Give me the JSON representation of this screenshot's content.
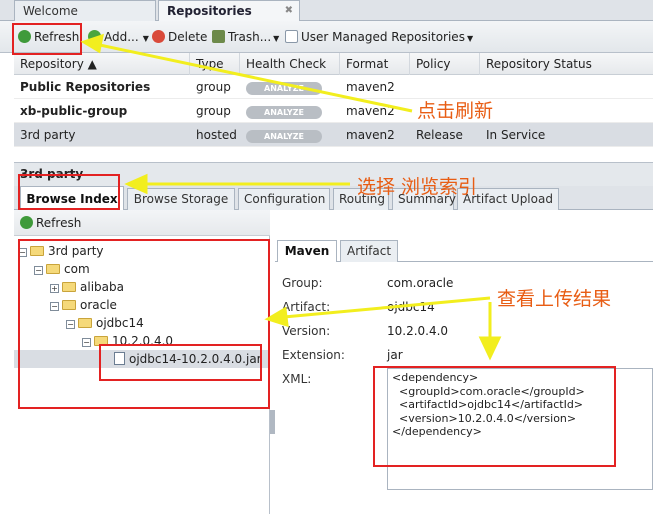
{
  "tabs": [
    {
      "label": "Welcome"
    },
    {
      "label": "Repositories",
      "close": "✖"
    }
  ],
  "toolbar": {
    "refresh": "Refresh",
    "add": "Add...",
    "delete": "Delete",
    "trash": "Trash...",
    "user_managed": "User Managed Repositories"
  },
  "grid": {
    "headers": [
      "Repository ▲",
      "Type",
      "Health Check",
      "Format",
      "Policy",
      "Repository Status"
    ],
    "analyze_label": "ANALYZE",
    "rows": [
      {
        "name": "Public Repositories",
        "type": "group",
        "format": "maven2",
        "policy": "",
        "status": ""
      },
      {
        "name": "xb-public-group",
        "type": "group",
        "format": "maven2",
        "policy": "",
        "status": ""
      },
      {
        "name": "3rd party",
        "type": "hosted",
        "format": "maven2",
        "policy": "Release",
        "status": "In Service"
      }
    ]
  },
  "panel": {
    "title": "3rd party",
    "tabs": [
      "Browse Index",
      "Browse Storage",
      "Configuration",
      "Routing",
      "Summary",
      "Artifact Upload"
    ]
  },
  "tree": {
    "refresh": "Refresh",
    "nodes": [
      "3rd party",
      "com",
      "alibaba",
      "oracle",
      "ojdbc14",
      "10.2.0.4.0",
      "ojdbc14-10.2.0.4.0.jar"
    ]
  },
  "detail": {
    "tabs": [
      "Maven",
      "Artifact"
    ],
    "fields": [
      {
        "label": "Group:",
        "value": "com.oracle"
      },
      {
        "label": "Artifact:",
        "value": "ojdbc14"
      },
      {
        "label": "Version:",
        "value": "10.2.0.4.0"
      },
      {
        "label": "Extension:",
        "value": "jar"
      }
    ],
    "xml_label": "XML:",
    "xml": "<dependency>\n  <groupId>com.oracle</groupId>\n  <artifactId>ojdbc14</artifactId>\n  <version>10.2.0.4.0</version>\n</dependency>"
  },
  "annotations": {
    "refresh_note": "点击刷新",
    "browse_note": "选择 浏览索引",
    "result_note": "查看上传结果"
  },
  "colors": {
    "annotation_box": "#e32222",
    "annotation_arrow": "#f2ee1e",
    "annotation_text": "#e85d14"
  }
}
